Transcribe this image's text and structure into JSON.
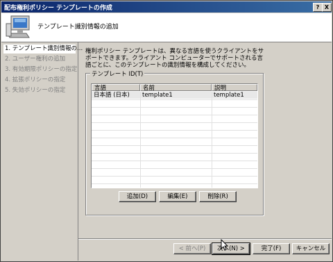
{
  "window": {
    "title": "配布権利ポリシー テンプレートの作成"
  },
  "titlebar_buttons": {
    "help": "?",
    "close": "X"
  },
  "header": {
    "title": "テンプレート識別情報の追加"
  },
  "steps": [
    {
      "label": "1. テンプレート識別情報の..."
    },
    {
      "label": "2. ユーザー権利の追加"
    },
    {
      "label": "3. 有効期限ポリシーの指定"
    },
    {
      "label": "4. 拡張ポリシーの指定"
    },
    {
      "label": "5. 失効ポリシーの指定"
    }
  ],
  "description": "権利ポリシー テンプレートは、異なる言語を使うクライアントをサポートできます。クライアント コンピューターでサポートされる言語ごとに、このテンプレートの識別情報を構成してください。",
  "group": {
    "label": "テンプレート ID(T)"
  },
  "table": {
    "columns": [
      "言語",
      "名前",
      "説明"
    ],
    "rows": [
      {
        "language": "日本語 (日本)",
        "name": "template1",
        "description": "template1"
      }
    ]
  },
  "buttons": {
    "add": "追加(D)",
    "edit": "編集(E)",
    "delete": "削除(R)",
    "back": "< 前へ(P)",
    "next": "次へ(N) >",
    "finish": "完了(F)",
    "cancel": "キャンセル"
  }
}
